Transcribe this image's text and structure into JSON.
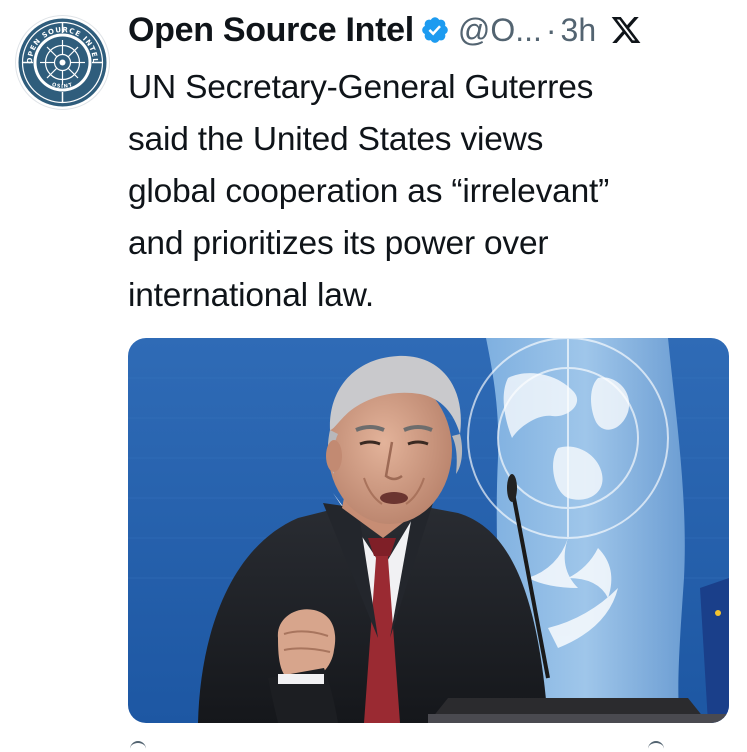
{
  "account": {
    "display_name": "Open Source Intel",
    "handle": "@O...",
    "separator": "·",
    "timestamp": "3h",
    "verified": true,
    "avatar_icon": "osint-logo-icon",
    "avatar_text_top": "OPEN SOURCE INTEL",
    "avatar_text_bottom": "OSINT"
  },
  "tweet": {
    "text_lines": [
      "UN Secretary-General Guterres",
      "said the United States views",
      "global cooperation as “irrelevant”",
      "and prioritizes its power over",
      "international law."
    ]
  },
  "media": {
    "type": "photo",
    "alt": "Photo of Guterres speaking at a podium in front of a UN flag"
  },
  "colors": {
    "text_primary": "#0f1419",
    "text_secondary": "#536471",
    "verified_blue": "#1d9bf0",
    "background": "#ffffff"
  },
  "icons": {
    "verified": "verified-badge-icon",
    "platform": "x-logo-icon"
  }
}
